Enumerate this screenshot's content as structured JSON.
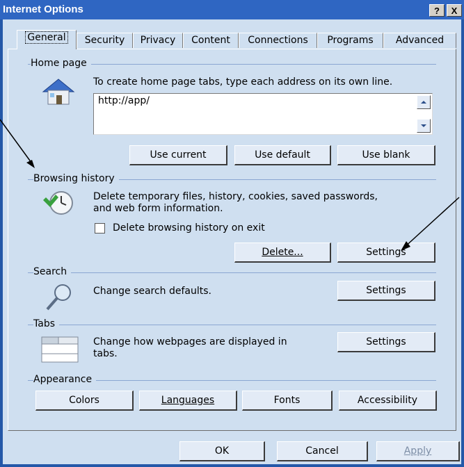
{
  "window": {
    "title": "Internet Options",
    "help_label": "?",
    "close_label": "X"
  },
  "tabs": [
    {
      "label": "General"
    },
    {
      "label": "Security"
    },
    {
      "label": "Privacy"
    },
    {
      "label": "Content"
    },
    {
      "label": "Connections"
    },
    {
      "label": "Programs"
    },
    {
      "label": "Advanced"
    }
  ],
  "home": {
    "group": "Home page",
    "instructions": "To create home page tabs, type each address on its own line.",
    "address": "http://app/",
    "use_current": "Use current",
    "use_default": "Use default",
    "use_blank": "Use blank"
  },
  "history": {
    "group": "Browsing history",
    "desc_line1": "Delete temporary files, history, cookies, saved passwords,",
    "desc_line2": "and web form information.",
    "delete_on_exit": "Delete browsing history on exit",
    "delete_label": "Delete...",
    "settings_label": "Settings"
  },
  "search": {
    "group": "Search",
    "desc": "Change search defaults.",
    "settings_label": "Settings"
  },
  "tabs_group": {
    "group": "Tabs",
    "desc_line1": "Change how webpages are displayed in",
    "desc_line2": "tabs.",
    "settings_label": "Settings"
  },
  "appearance": {
    "group": "Appearance",
    "colors": "Colors",
    "languages": "Languages",
    "fonts": "Fonts",
    "accessibility": "Accessibility"
  },
  "footer": {
    "ok": "OK",
    "cancel": "Cancel",
    "apply": "Apply"
  }
}
